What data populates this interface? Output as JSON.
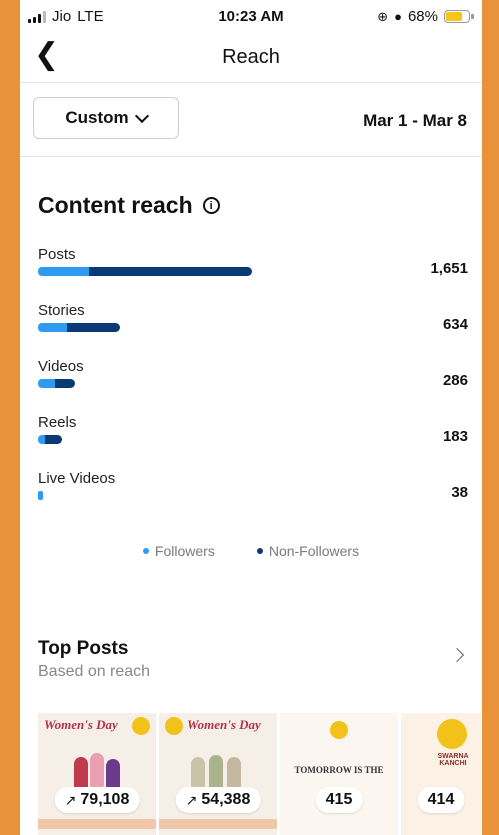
{
  "status_bar": {
    "carrier": "Jio",
    "network": "LTE",
    "time": "10:23 AM",
    "battery": "68%"
  },
  "header": {
    "title": "Reach",
    "back_icon": "back-chevron-icon"
  },
  "filter": {
    "range_label": "Custom",
    "date_range": "Mar 1 - Mar 8"
  },
  "content_reach": {
    "title": "Content reach",
    "metrics": [
      {
        "label": "Posts",
        "value": "1,651",
        "followers_pct": 24,
        "nonfollowers_pct": 76
      },
      {
        "label": "Stories",
        "value": "634",
        "followers_pct": 35,
        "nonfollowers_pct": 65
      },
      {
        "label": "Videos",
        "value": "286",
        "followers_pct": 45,
        "nonfollowers_pct": 55
      },
      {
        "label": "Reels",
        "value": "183",
        "followers_pct": 30,
        "nonfollowers_pct": 70
      },
      {
        "label": "Live Videos",
        "value": "38",
        "followers_pct": 100,
        "nonfollowers_pct": 0
      }
    ],
    "legend": {
      "followers": "Followers",
      "non_followers": "Non-Followers"
    },
    "colors": {
      "followers": "#2e9bf0",
      "non_followers": "#0a3a73"
    }
  },
  "top_posts": {
    "title": "Top Posts",
    "subtitle": "Based on reach",
    "posts": [
      {
        "reach": "79,108",
        "caption": "Women's Day"
      },
      {
        "reach": "54,388",
        "caption": "Women's Day"
      },
      {
        "reach": "415",
        "caption": "TOMORROW IS THE"
      },
      {
        "reach": "414",
        "caption": "SWARNA KANCHI"
      }
    ]
  }
}
